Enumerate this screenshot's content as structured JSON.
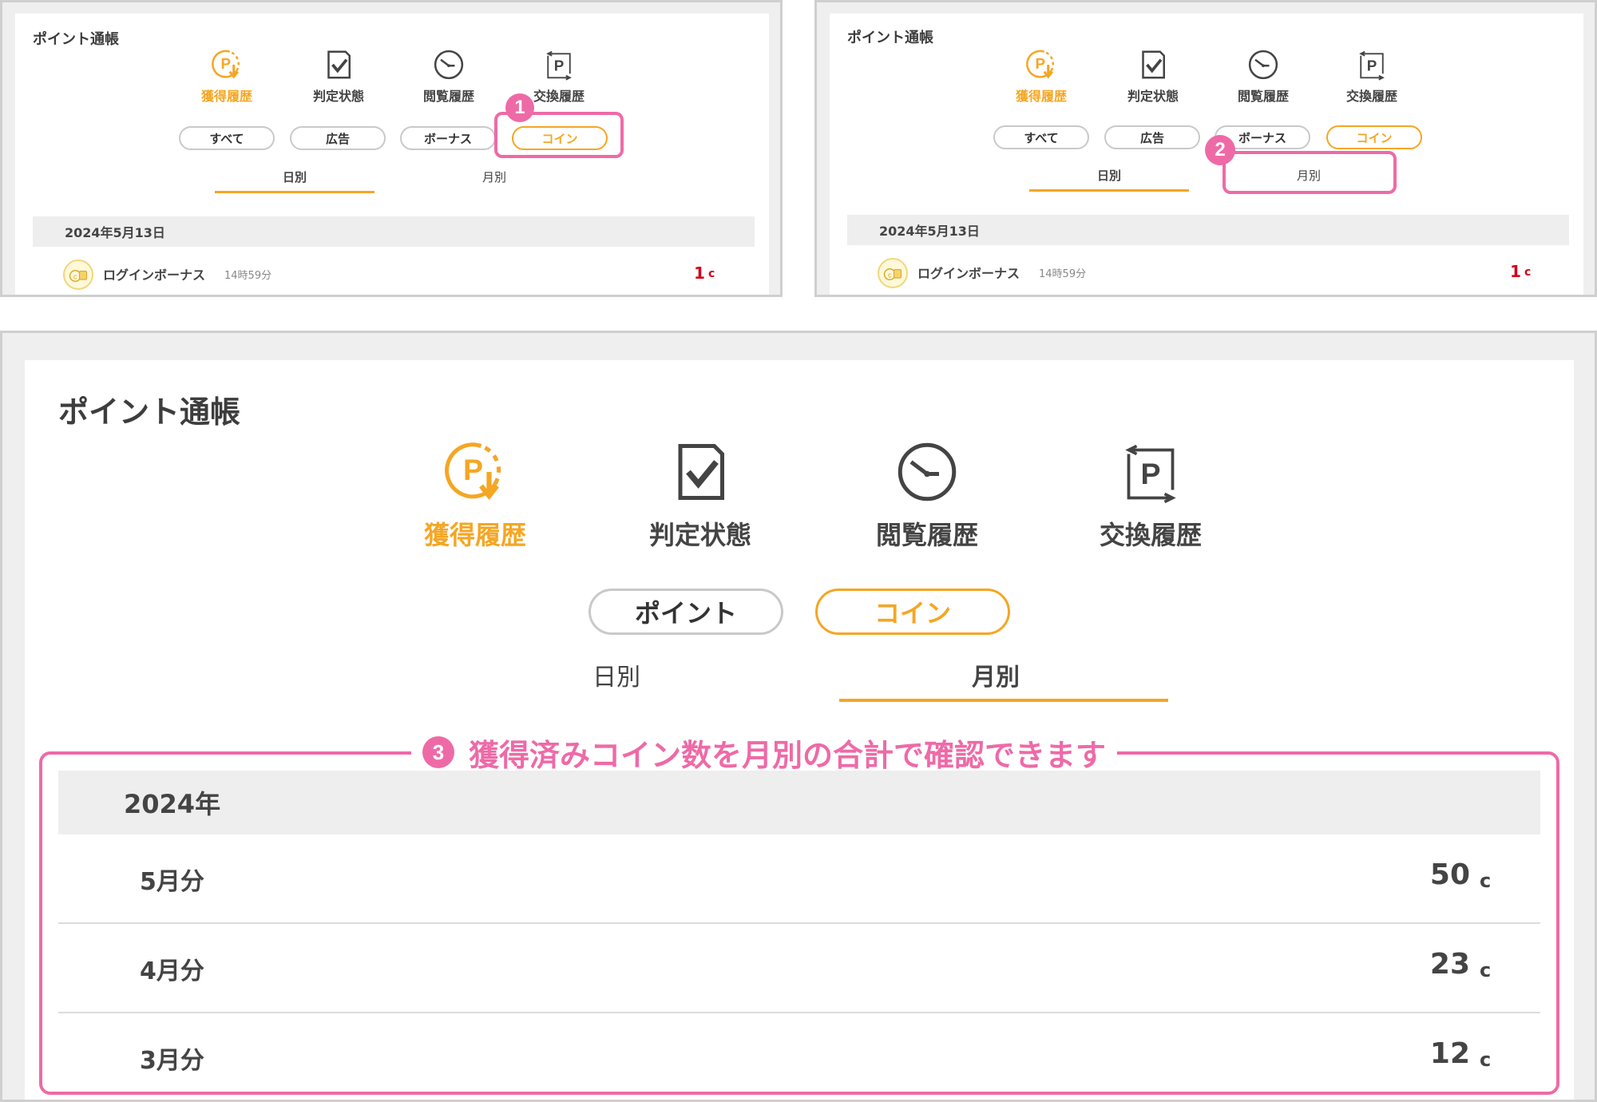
{
  "page_title": "ポイント通帳",
  "tabs": [
    {
      "label": "獲得履歴",
      "icon": "point-earn-icon"
    },
    {
      "label": "判定状態",
      "icon": "checklist-icon"
    },
    {
      "label": "閲覧履歴",
      "icon": "clock-icon"
    },
    {
      "label": "交換履歴",
      "icon": "point-exchange-icon"
    }
  ],
  "top_filters": [
    "すべて",
    "広告",
    "ボーナス",
    "コイン"
  ],
  "bottom_filters": [
    "ポイント",
    "コイン"
  ],
  "periods": [
    "日別",
    "月別"
  ],
  "date_band": "2024年5月13日",
  "history_row": {
    "label": "ログインボーナス",
    "time": "14時59分",
    "amount": "1",
    "unit": "c"
  },
  "badges": [
    "1",
    "2",
    "3"
  ],
  "caption": "獲得済みコイン数を月別の合計で確認できます",
  "monthly": {
    "year": "2024年",
    "rows": [
      {
        "label": "5月分",
        "amount": "50",
        "unit": "c"
      },
      {
        "label": "4月分",
        "amount": "23",
        "unit": "c"
      },
      {
        "label": "3月分",
        "amount": "12",
        "unit": "c"
      }
    ]
  },
  "colors": {
    "accent": "#f5a623",
    "highlight": "#ee6aa7",
    "amount_red": "#d0021b"
  }
}
